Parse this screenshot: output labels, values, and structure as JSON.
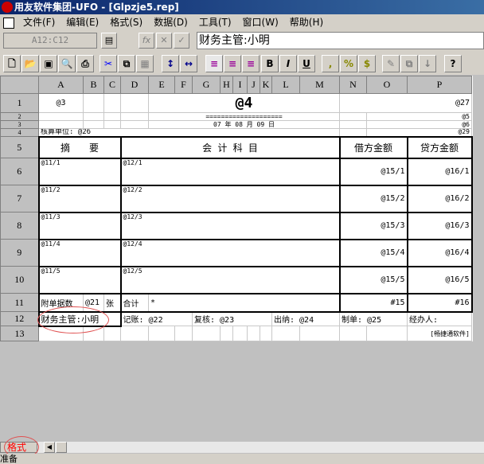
{
  "window": {
    "title": "用友软件集团-UFO - [Glpzje5.rep]"
  },
  "menu": [
    "文件(F)",
    "编辑(E)",
    "格式(S)",
    "数据(D)",
    "工具(T)",
    "窗口(W)",
    "帮助(H)"
  ],
  "formula_bar": {
    "cell_ref": "A12:C12",
    "value": "财务主管:小明"
  },
  "toolbar": {
    "bold": "B",
    "italic": "I",
    "underline": "U",
    "comma": ",",
    "percent": "%",
    "currency": "$"
  },
  "columns": [
    "A",
    "B",
    "C",
    "D",
    "E",
    "F",
    "G",
    "H",
    "I",
    "J",
    "K",
    "L",
    "M",
    "N",
    "O",
    "P"
  ],
  "cells": {
    "r1": {
      "a": "@3",
      "title": "@4",
      "right": "@27"
    },
    "r2": {
      "line": "====================",
      "right": "@5"
    },
    "r3": {
      "date": "07 年 08 月 09 日",
      "right": "@6"
    },
    "r4": {
      "unit": "核算单位: @26",
      "right": "@29"
    },
    "r5": {
      "summary": "摘　　要",
      "account": "会 计 科 目",
      "debit": "借方金额",
      "credit": "贷方金额"
    },
    "rows": [
      {
        "s": "@11/1",
        "a": "@12/1",
        "d": "@15/1",
        "c": "@16/1"
      },
      {
        "s": "@11/2",
        "a": "@12/2",
        "d": "@15/2",
        "c": "@16/2"
      },
      {
        "s": "@11/3",
        "a": "@12/3",
        "d": "@15/3",
        "c": "@16/3"
      },
      {
        "s": "@11/4",
        "a": "@12/4",
        "d": "@15/4",
        "c": "@16/4"
      },
      {
        "s": "@11/5",
        "a": "@12/5",
        "d": "@15/5",
        "c": "@16/5"
      }
    ],
    "r11": {
      "attach": "附单据数",
      "count": "@21",
      "unit": "张",
      "total": "合计",
      "star": "*",
      "debit": "#15",
      "credit": "#16"
    },
    "r12": {
      "manager": "财务主管:小明",
      "bookkeeper": "记账: @22",
      "review": "复核: @23",
      "cashier": "出纳: @24",
      "maker": "制单: @25",
      "handler": "经办人:"
    },
    "r13": {
      "brand": "[畅捷通软件]"
    }
  },
  "sheet_tab": "格式",
  "status": "准备"
}
